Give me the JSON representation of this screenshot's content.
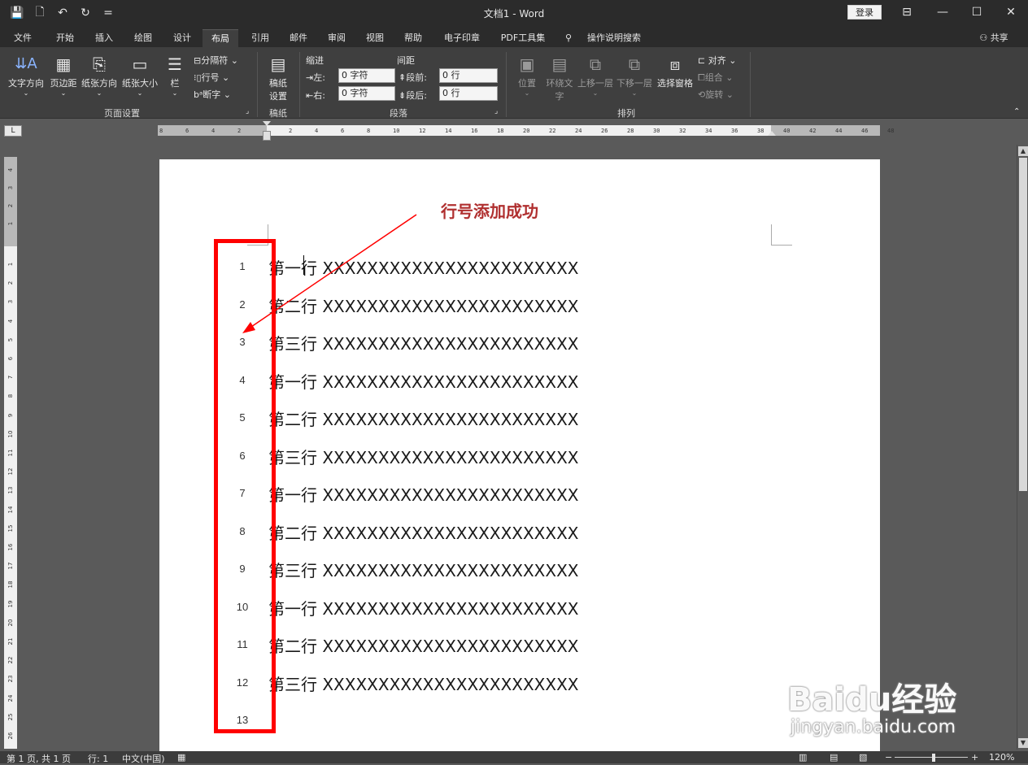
{
  "titlebar": {
    "title": "文档1  -  Word",
    "login": "登录",
    "qat": [
      {
        "name": "save-icon",
        "glyph": "💾"
      },
      {
        "name": "print-preview-icon",
        "glyph": "🗋"
      },
      {
        "name": "undo-icon",
        "glyph": "↶"
      },
      {
        "name": "redo-icon",
        "glyph": "↻"
      },
      {
        "name": "customize-qat-icon",
        "glyph": "="
      }
    ]
  },
  "menu": {
    "tabs": [
      "文件",
      "开始",
      "插入",
      "绘图",
      "设计",
      "布局",
      "引用",
      "邮件",
      "审阅",
      "视图",
      "帮助",
      "电子印章",
      "PDF工具集"
    ],
    "active": "布局",
    "tell_me": "操作说明搜索",
    "share": "共享"
  },
  "ribbon": {
    "page_setup": {
      "label": "页面设置",
      "text_direction": "文字方向",
      "margins": "页边距",
      "orientation": "纸张方向",
      "size": "纸张大小",
      "columns": "栏",
      "breaks": "分隔符",
      "line_numbers": "行号",
      "hyphenation": "断字"
    },
    "draft": {
      "label": "稿纸",
      "button_line1": "稿纸",
      "button_line2": "设置"
    },
    "paragraph": {
      "label": "段落",
      "indent_title": "缩进",
      "spacing_title": "间距",
      "left_label": "左:",
      "right_label": "右:",
      "before_label": "段前:",
      "after_label": "段后:",
      "left_value": "0 字符",
      "right_value": "0 字符",
      "before_value": "0 行",
      "after_value": "0 行"
    },
    "arrange": {
      "label": "排列",
      "position": "位置",
      "wrap_line1": "环绕文",
      "wrap_line2": "字",
      "bring_forward": "上移一层",
      "send_backward": "下移一层",
      "selection_pane": "选择窗格",
      "align": "对齐",
      "group": "组合",
      "rotate": "旋转"
    }
  },
  "ruler": {
    "corner": "L",
    "h_left": [
      "8",
      "6",
      "4",
      "2"
    ],
    "h_right": [
      "2",
      "4",
      "6",
      "8",
      "10",
      "12",
      "14",
      "16",
      "18",
      "20",
      "22",
      "24",
      "26",
      "28",
      "30",
      "32",
      "34",
      "36",
      "38",
      "40",
      "42",
      "44",
      "46",
      "48"
    ],
    "v_top": [
      "4",
      "3",
      "2",
      "1"
    ],
    "v_body": [
      "1",
      "2",
      "3",
      "4",
      "5",
      "6",
      "7",
      "8",
      "9",
      "10",
      "11",
      "12",
      "13",
      "14",
      "15",
      "16",
      "17",
      "18",
      "19",
      "20",
      "21",
      "22",
      "23",
      "24",
      "25",
      "26"
    ]
  },
  "document": {
    "annotation": "行号添加成功",
    "lines": [
      {
        "num": "1",
        "text": "第一行 XXXXXXXXXXXXXXXXXXXXXXX"
      },
      {
        "num": "2",
        "text": "第二行 XXXXXXXXXXXXXXXXXXXXXXX"
      },
      {
        "num": "3",
        "text": "第三行 XXXXXXXXXXXXXXXXXXXXXXX"
      },
      {
        "num": "4",
        "text": "第一行 XXXXXXXXXXXXXXXXXXXXXXX"
      },
      {
        "num": "5",
        "text": "第二行 XXXXXXXXXXXXXXXXXXXXXXX"
      },
      {
        "num": "6",
        "text": "第三行 XXXXXXXXXXXXXXXXXXXXXXX"
      },
      {
        "num": "7",
        "text": "第一行 XXXXXXXXXXXXXXXXXXXXXXX"
      },
      {
        "num": "8",
        "text": "第二行 XXXXXXXXXXXXXXXXXXXXXXX"
      },
      {
        "num": "9",
        "text": "第三行 XXXXXXXXXXXXXXXXXXXXXXX"
      },
      {
        "num": "10",
        "text": "第一行 XXXXXXXXXXXXXXXXXXXXXXX"
      },
      {
        "num": "11",
        "text": "第二行 XXXXXXXXXXXXXXXXXXXXXXX"
      },
      {
        "num": "12",
        "text": "第三行 XXXXXXXXXXXXXXXXXXXXXXX"
      },
      {
        "num": "13",
        "text": ""
      }
    ]
  },
  "status": {
    "page": "第 1 页, 共 1 页",
    "line": "行: 1",
    "language": "中文(中国)",
    "zoom": "120%"
  },
  "watermark": {
    "brand": "Baidu经验",
    "url": "jingyan.baidu.com"
  },
  "colors": {
    "highlight": "#ff0000",
    "annotation": "#b03030",
    "chrome": "#2b2b2b",
    "ribbon": "#3f3f3f"
  }
}
